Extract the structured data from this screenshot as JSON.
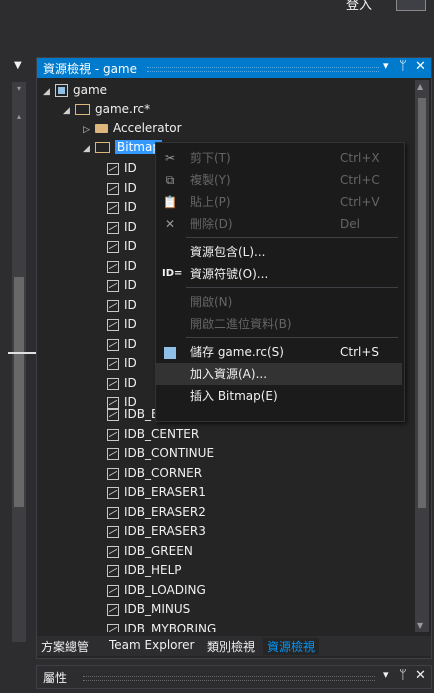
{
  "topbar": {
    "partial_label": "登入"
  },
  "panel": {
    "title": "資源檢視 - game",
    "controls": {
      "dropdown": "▾",
      "pin": "ᛘ",
      "close": "✕"
    }
  },
  "tree": {
    "root": "game",
    "rc_file": "game.rc*",
    "accelerator": "Accelerator",
    "bitmap_folder": "Bitmap",
    "truncated_prefix": "ID",
    "bitmaps": [
      "IDB_BLUE",
      "IDB_CENTER",
      "IDB_CONTINUE",
      "IDB_CORNER",
      "IDB_ERASER1",
      "IDB_ERASER2",
      "IDB_ERASER3",
      "IDB_GREEN",
      "IDB_HELP",
      "IDB_LOADING",
      "IDB_MINUS",
      "IDB_MYBORING"
    ]
  },
  "tabs": [
    "方案總管",
    "Team Explorer",
    "類別檢視",
    "資源檢視"
  ],
  "properties": {
    "title": "屬性",
    "controls": {
      "dropdown": "▾",
      "pin": "ᛘ",
      "close": "✕"
    }
  },
  "context_menu": {
    "items": [
      {
        "label": "剪下(T)",
        "shortcut": "Ctrl+X",
        "icon": "cut-icon",
        "glyph": "✂",
        "enabled": false
      },
      {
        "label": "複製(Y)",
        "shortcut": "Ctrl+C",
        "icon": "copy-icon",
        "glyph": "⧉",
        "enabled": false
      },
      {
        "label": "貼上(P)",
        "shortcut": "Ctrl+V",
        "icon": "paste-icon",
        "glyph": "📋",
        "enabled": false
      },
      {
        "label": "刪除(D)",
        "shortcut": "Del",
        "icon": "delete-icon",
        "glyph": "✕",
        "enabled": false
      },
      {
        "label": "資源包含(L)...",
        "shortcut": "",
        "icon": "",
        "glyph": "",
        "enabled": true
      },
      {
        "label": "資源符號(O)...",
        "shortcut": "",
        "icon": "id-icon",
        "glyph": "ID=",
        "enabled": true
      },
      {
        "label": "開啟(N)",
        "shortcut": "",
        "icon": "",
        "glyph": "",
        "enabled": false
      },
      {
        "label": "開啟二進位資料(B)",
        "shortcut": "",
        "icon": "",
        "glyph": "",
        "enabled": false
      },
      {
        "label": "儲存 game.rc(S)",
        "shortcut": "Ctrl+S",
        "icon": "save-icon",
        "glyph": "",
        "enabled": true
      },
      {
        "label": "加入資源(A)...",
        "shortcut": "",
        "icon": "",
        "glyph": "",
        "enabled": true
      },
      {
        "label": "插入 Bitmap(E)",
        "shortcut": "",
        "icon": "",
        "glyph": "",
        "enabled": true
      }
    ]
  }
}
